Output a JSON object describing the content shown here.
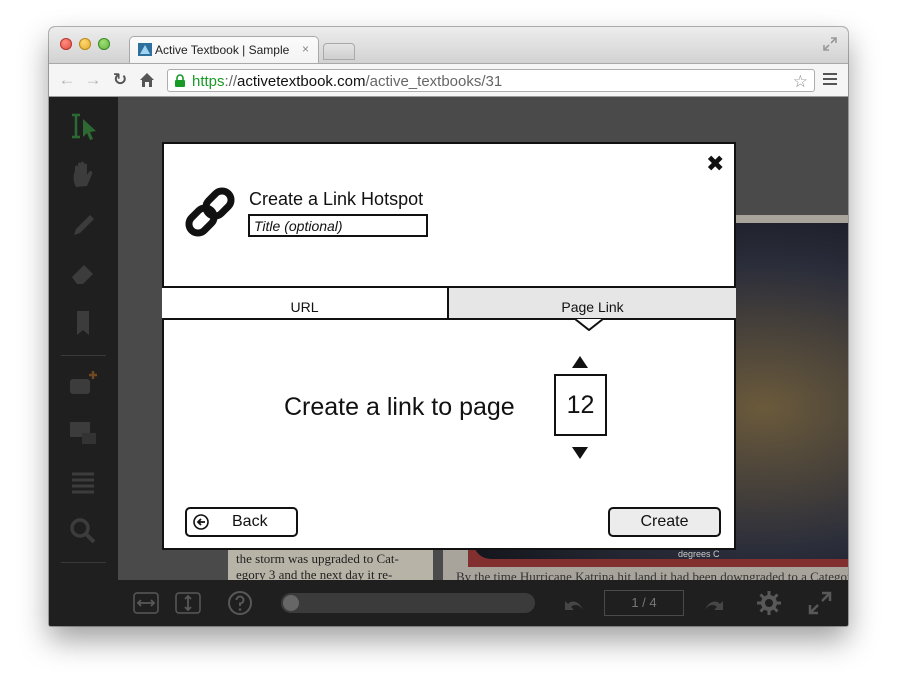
{
  "browser": {
    "tab_title": "Active Textbook | Sample",
    "tab_close": "×",
    "url_scheme": "https",
    "url_separator": "://",
    "url_host": "activetextbook.com",
    "url_path": "/active_textbooks/31"
  },
  "reader": {
    "left_page_text_1": "the storm was upgraded to Cat-",
    "left_page_text_2": "egory 3 and the next day it re-",
    "figure_axis_label": "degrees C",
    "right_page_caption": "By the time Hurricane Katrina hit land it had been downgraded to a Category",
    "page_counter": "1 / 4"
  },
  "modal": {
    "close_glyph": "✖",
    "heading": "Create a Link Hotspot",
    "title_placeholder": "Title (optional)",
    "tabs": {
      "url_label": "URL",
      "page_link_label": "Page Link",
      "active": "Page Link"
    },
    "link_prompt": "Create a link to page",
    "page_number": "12",
    "back_label": "Back",
    "create_label": "Create"
  },
  "colors": {
    "url_scheme_green": "#1a9a26",
    "active_tab_bg": "#e6e6e6"
  }
}
